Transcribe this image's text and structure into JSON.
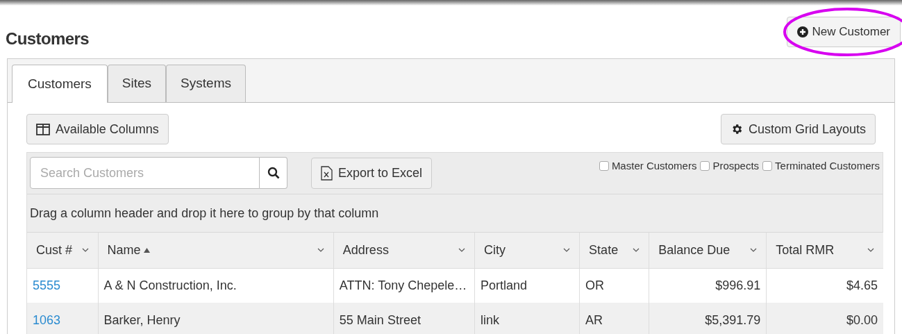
{
  "page_title": "Customers",
  "new_button": {
    "label": "New Customer",
    "highlighted": true
  },
  "tabs": [
    {
      "label": "Customers",
      "selected": true
    },
    {
      "label": "Sites",
      "selected": false
    },
    {
      "label": "Systems",
      "selected": false
    }
  ],
  "toolbar": {
    "columns_button": "Available Columns",
    "layouts_button": "Custom Grid Layouts"
  },
  "search": {
    "placeholder": "Search Customers"
  },
  "export_button": "Export to Excel",
  "filters": [
    {
      "label": "Master Customers",
      "checked": false
    },
    {
      "label": "Prospects",
      "checked": false
    },
    {
      "label": "Terminated Customers",
      "checked": false
    }
  ],
  "group_hint": "Drag a column header and drop it here to group by that column",
  "table": {
    "columns": [
      {
        "label": "Cust #",
        "kind": "link",
        "sorted": false
      },
      {
        "label": "Name",
        "kind": "text",
        "sorted": true
      },
      {
        "label": "Address",
        "kind": "text",
        "sorted": false
      },
      {
        "label": "City",
        "kind": "text",
        "sorted": false
      },
      {
        "label": "State",
        "kind": "text",
        "sorted": false
      },
      {
        "label": "Balance Due",
        "kind": "money",
        "sorted": false
      },
      {
        "label": "Total RMR",
        "kind": "money",
        "sorted": false
      }
    ],
    "rows": [
      [
        "5555",
        "A & N Construction, Inc.",
        "ATTN: Tony Chepele…",
        "Portland",
        "OR",
        "$996.91",
        "$4.65"
      ],
      [
        "1063",
        "Barker, Henry",
        "55 Main Street",
        "link",
        "AR",
        "$5,391.79",
        "$0.00"
      ]
    ]
  }
}
